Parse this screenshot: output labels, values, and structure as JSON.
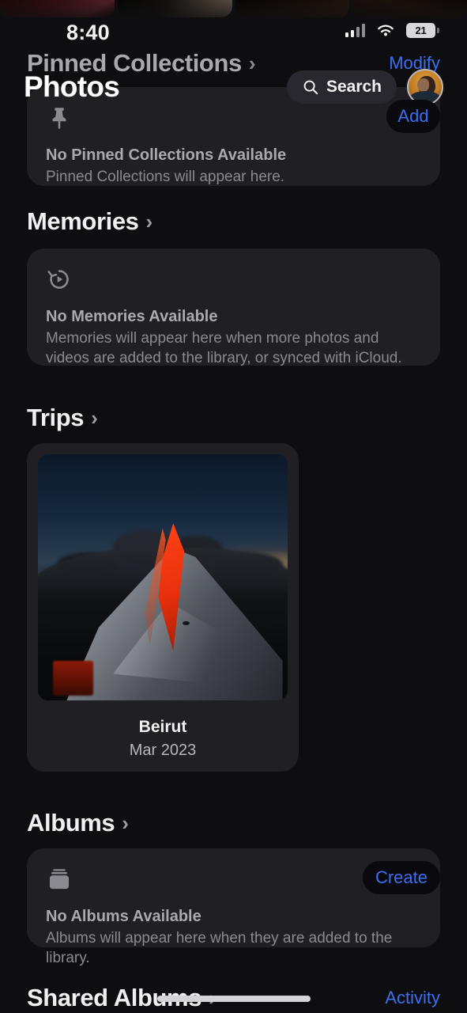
{
  "status_bar": {
    "time": "8:40",
    "cellular_icon": "cellular-bars-icon",
    "wifi_icon": "wifi-icon",
    "battery_percent": "21"
  },
  "nav": {
    "title": "Photos",
    "search_label": "Search",
    "search_icon": "search-icon",
    "avatar_name": "account-avatar"
  },
  "sections": {
    "pinned": {
      "title": "Pinned Collections",
      "chevron": "›",
      "modify_label": "Modify",
      "add_label": "Add",
      "icon": "pin-icon",
      "empty_title": "No Pinned Collections Available",
      "empty_subtitle": "Pinned Collections will appear here."
    },
    "memories": {
      "title": "Memories",
      "chevron": "›",
      "icon": "memories-replay-icon",
      "empty_title": "No Memories Available",
      "empty_subtitle": "Memories will appear here when more photos and videos are added to the library, or synced with iCloud."
    },
    "trips": {
      "title": "Trips",
      "chevron": "›",
      "card": {
        "name": "Beirut",
        "date": "Mar 2023",
        "photo_alt": "airplane-wing-at-dusk-photo"
      }
    },
    "albums": {
      "title": "Albums",
      "chevron": "›",
      "create_label": "Create",
      "icon": "albums-stack-icon",
      "empty_title": "No Albums Available",
      "empty_subtitle": "Albums will appear here when they are added to the library."
    },
    "shared_albums": {
      "title": "Shared Albums",
      "chevron": "›",
      "activity_label": "Activity"
    }
  },
  "colors": {
    "background": "#0e0e10",
    "card": "#1f1f24",
    "accent_blue": "#3b6ef0",
    "primary_text": "#f0f0f2",
    "secondary_text": "#8a8a90"
  }
}
